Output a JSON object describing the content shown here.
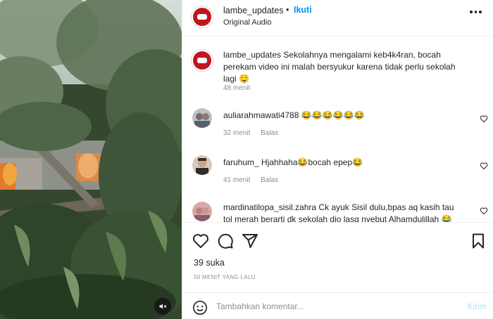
{
  "header": {
    "username": "lambe_updates",
    "bullet": "•",
    "follow_label": "Ikuti",
    "audio_label": "Original Audio"
  },
  "caption": {
    "username": "lambe_updates",
    "text": "Sekolahnya mengalami keb4k4ran, bocah perekam video ini malah bersyukur karena tidak perlu sekolah lagi 🤤",
    "time": "48 menit"
  },
  "comments": [
    {
      "username": "auliarahmawati4788",
      "text": "😂😂😂😂😂😂",
      "time": "32 menit",
      "reply_label": "Balas"
    },
    {
      "username": "faruhum_",
      "text": "Hjahhaha😂bocah epep😂",
      "time": "41 menit",
      "reply_label": "Balas"
    },
    {
      "username": "mardinatilopa_sisil.zahra",
      "text": "Ck ayuk Sisil dulu,bpas aq kasih tau tol merah berarti dk sekolah dio lasg nyebut Alhamdulillah 😂",
      "time": "",
      "reply_label": ""
    }
  ],
  "actions": {
    "likes": "39 suka",
    "time_ago": "50 MENIT YANG LALU"
  },
  "composer": {
    "placeholder": "Tambahkan komentar...",
    "post_label": "Kirim"
  },
  "icons": {
    "like": "heart-icon",
    "comment": "comment-icon",
    "share": "share-icon",
    "save": "bookmark-icon",
    "emoji": "emoji-icon",
    "mute": "speaker-muted-icon",
    "more": "more-options-icon"
  },
  "colors": {
    "accent": "#0095f6",
    "post_disabled": "#b3dffc",
    "meta": "#8e8e8e",
    "brand_red": "#c0161d"
  }
}
